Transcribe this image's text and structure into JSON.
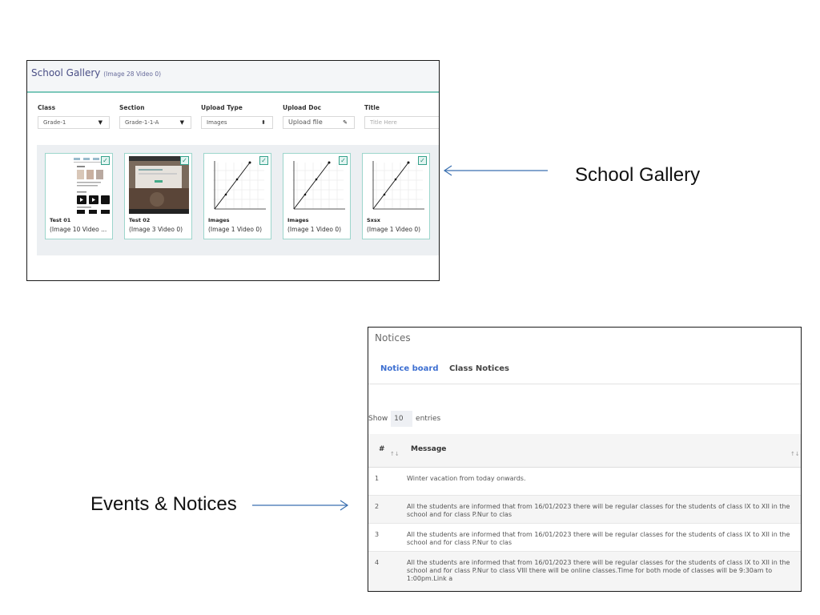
{
  "gallery": {
    "title": "School Gallery",
    "title_count": "(Image 28 Video 0)",
    "fields": [
      {
        "label": "Class",
        "value": "Grade-1"
      },
      {
        "label": "Section",
        "value": "Grade-1-1-A"
      },
      {
        "label": "Upload Type",
        "value": "Images"
      },
      {
        "label": "Upload Doc",
        "value": "Upload file"
      },
      {
        "label": "Title",
        "placeholder": "Title Here"
      }
    ],
    "items": [
      {
        "name": "Test 01",
        "count": "(Image 10 Video ..."
      },
      {
        "name": "Test 02",
        "count": "(Image 3 Video 0)"
      },
      {
        "name": "Images",
        "count": "(Image 1 Video 0)"
      },
      {
        "name": "Images",
        "count": "(Image 1 Video 0)"
      },
      {
        "name": "Sxsx",
        "count": "(Image 1 Video 0)"
      }
    ]
  },
  "annotations": {
    "gallery_label": "School Gallery",
    "notices_label": "Events & Notices"
  },
  "notices": {
    "title": "Notices",
    "tabs": [
      "Notice board",
      "Class Notices"
    ],
    "show_prefix": "Show",
    "show_value": "10",
    "show_suffix": "entries",
    "columns": [
      "#",
      "Message"
    ],
    "rows": [
      {
        "num": "1",
        "message": "Winter vacation from today onwards."
      },
      {
        "num": "2",
        "message": "All the students are informed that from 16/01/2023 there will be regular classes for the students of class IX to XII in the school and for class P.Nur to clas"
      },
      {
        "num": "3",
        "message": "All the students are informed that from 16/01/2023 there will be regular classes for the students of class IX to XII in the school and for class P.Nur to clas"
      },
      {
        "num": "4",
        "message": "All the students are informed that from 16/01/2023 there will be regular classes for the students of class IX to XII in the school and for class P.Nur to class VIII there will be online classes.Time for both mode of classes will be 9:30am to 1:00pm.Link a"
      }
    ]
  },
  "colors": {
    "accent_teal": "#7cc8ba",
    "tab_active": "#3d6fd1",
    "annotation_arrow": "#3a6fb0"
  }
}
